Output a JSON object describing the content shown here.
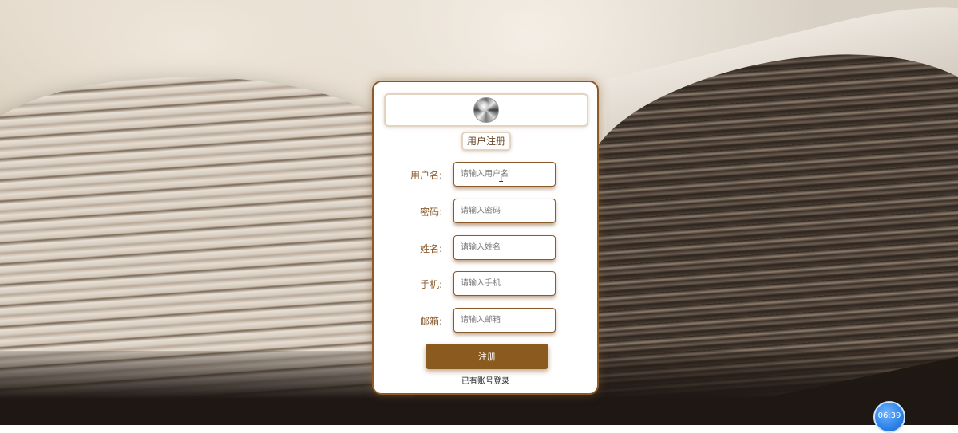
{
  "register": {
    "title": "用户注册",
    "fields": [
      {
        "label": "用户名:",
        "placeholder": "请输入用户名"
      },
      {
        "label": "密码:",
        "placeholder": "请输入密码"
      },
      {
        "label": "姓名:",
        "placeholder": "请输入姓名"
      },
      {
        "label": "手机:",
        "placeholder": "请输入手机"
      },
      {
        "label": "邮箱:",
        "placeholder": "请输入邮箱"
      }
    ],
    "submit_label": "注册",
    "login_link": "已有账号登录"
  },
  "clock": {
    "time": "06:39"
  },
  "icons": {
    "avatar": "avatar-image",
    "cursor": "text-cursor-icon"
  },
  "colors": {
    "accent": "#8b5a2b",
    "button": "#8b5a1f"
  }
}
